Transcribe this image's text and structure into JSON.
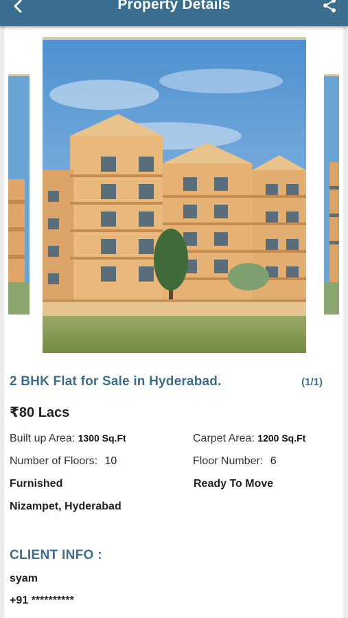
{
  "header": {
    "title": "Property Details",
    "back_icon": "back-arrow-icon",
    "share_icon": "share-icon",
    "color": "#3b6e8e"
  },
  "gallery": {
    "counter": "(1/1)"
  },
  "property": {
    "title": "2 BHK Flat for Sale in Hyderabad.",
    "price": "₹80 Lacs",
    "built_up_label": "Built up Area:",
    "built_up_value": "1300 Sq.Ft",
    "carpet_label": "Carpet Area:",
    "carpet_value": "1200 Sq.Ft",
    "floors_label": "Number of Floors:",
    "floors_value": "10",
    "floor_number_label": "Floor Number:",
    "floor_number_value": "6",
    "furnishing": "Furnished",
    "status": "Ready To Move",
    "location": "Nizampet, Hyderabad"
  },
  "client": {
    "heading": "CLIENT INFO :",
    "name": "syam",
    "phone": "+91 **********"
  }
}
